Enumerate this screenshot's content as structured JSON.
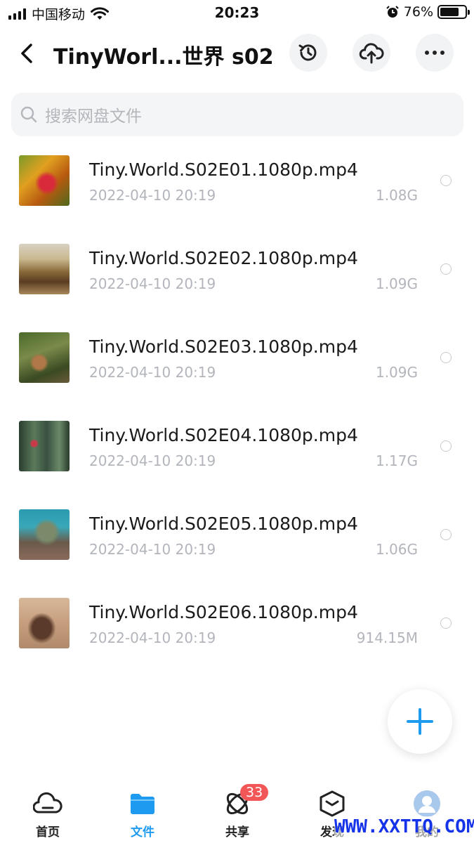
{
  "status": {
    "carrier": "中国移动",
    "time": "20:23",
    "battery": "76%",
    "battery_level": 0.76
  },
  "header": {
    "title": "TinyWorl...世界 s02",
    "icons": [
      "back-icon",
      "history-icon",
      "cloud-upload-icon",
      "more-icon"
    ]
  },
  "search": {
    "placeholder": "搜索网盘文件"
  },
  "files": [
    {
      "name": "Tiny.World.S02E01.1080p.mp4",
      "date": "2022-04-10 20:19",
      "size": "1.08G"
    },
    {
      "name": "Tiny.World.S02E02.1080p.mp4",
      "date": "2022-04-10 20:19",
      "size": "1.09G"
    },
    {
      "name": "Tiny.World.S02E03.1080p.mp4",
      "date": "2022-04-10 20:19",
      "size": "1.09G"
    },
    {
      "name": "Tiny.World.S02E04.1080p.mp4",
      "date": "2022-04-10 20:19",
      "size": "1.17G"
    },
    {
      "name": "Tiny.World.S02E05.1080p.mp4",
      "date": "2022-04-10 20:19",
      "size": "1.06G"
    },
    {
      "name": "Tiny.World.S02E06.1080p.mp4",
      "date": "2022-04-10 20:19",
      "size": "914.15M"
    }
  ],
  "tabs": [
    {
      "label": "首页"
    },
    {
      "label": "文件"
    },
    {
      "label": "共享",
      "badge": "33"
    },
    {
      "label": "发现"
    },
    {
      "label": "我的"
    }
  ],
  "watermark": "WWW.XXTTQ.COM",
  "colors": {
    "accent": "#1e9bf0",
    "badge": "#f25656"
  }
}
